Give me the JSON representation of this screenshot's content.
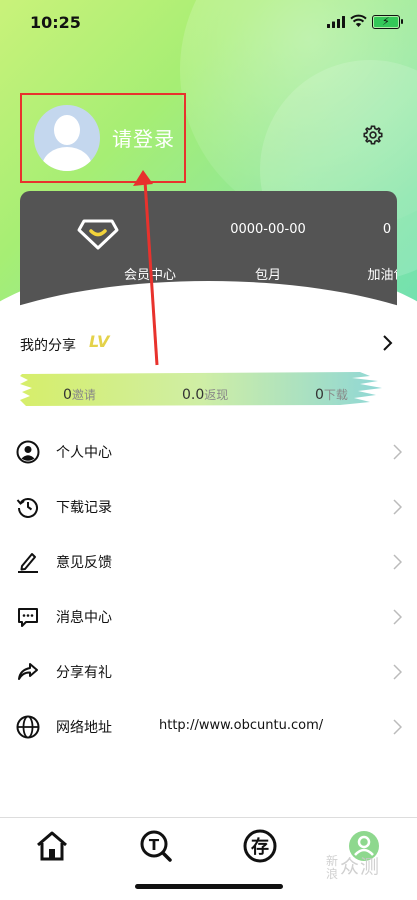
{
  "status_bar": {
    "time": "10:25"
  },
  "header": {
    "login_label": "请登录"
  },
  "member_card": {
    "items": [
      {
        "value": "",
        "label": "会员中心"
      },
      {
        "value": "0000-00-00",
        "label": "包月"
      },
      {
        "value": "0",
        "label": "加油包"
      }
    ]
  },
  "share": {
    "title": "我的分享",
    "level_badge": "LV",
    "stats": [
      {
        "value": "0",
        "unit": "邀请"
      },
      {
        "value": "0.0",
        "unit": "返现"
      },
      {
        "value": "0",
        "unit": "下载"
      }
    ]
  },
  "menu": {
    "items": [
      {
        "label": "个人中心",
        "icon": "user-circle-icon"
      },
      {
        "label": "下载记录",
        "icon": "history-icon"
      },
      {
        "label": "意见反馈",
        "icon": "edit-pen-icon"
      },
      {
        "label": "消息中心",
        "icon": "message-icon"
      },
      {
        "label": "分享有礼",
        "icon": "share-icon"
      },
      {
        "label": "网络地址",
        "icon": "globe-icon",
        "value": "http://www.obcuntu.com/"
      }
    ]
  },
  "tabbar": {
    "items": [
      {
        "icon": "home-icon"
      },
      {
        "icon": "search-t-icon"
      },
      {
        "icon": "store-icon",
        "glyph": "存"
      },
      {
        "icon": "profile-icon"
      }
    ]
  },
  "watermark": {
    "text_a": "新浪",
    "text_b": "众测"
  },
  "colors": {
    "accent_green": "#8fe79a",
    "card_bg": "#545454",
    "annotation_red": "#e8322d",
    "badge_yellow": "#e4d24a"
  }
}
